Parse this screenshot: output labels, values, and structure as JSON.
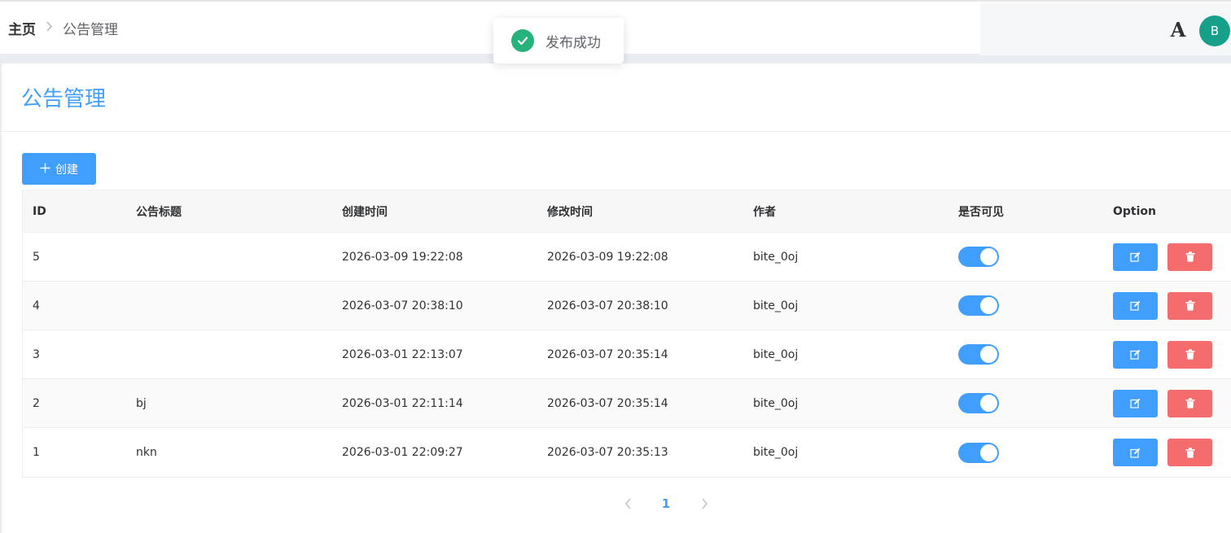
{
  "breadcrumb": {
    "home": "主页",
    "current": "公告管理"
  },
  "header": {
    "font_toggle": "A",
    "avatar_initial": "B"
  },
  "toast": {
    "message": "发布成功",
    "icon": "check-circle-icon",
    "color": "#26b27b"
  },
  "page": {
    "title": "公告管理",
    "create_label": "创建"
  },
  "table": {
    "columns": [
      "ID",
      "公告标题",
      "创建时间",
      "修改时间",
      "作者",
      "是否可见",
      "Option"
    ],
    "rows": [
      {
        "id": "5",
        "title": "",
        "created": "2026-03-09 19:22:08",
        "updated": "2026-03-09 19:22:08",
        "author": "bite_0oj",
        "visible": true
      },
      {
        "id": "4",
        "title": "",
        "created": "2026-03-07 20:38:10",
        "updated": "2026-03-07 20:38:10",
        "author": "bite_0oj",
        "visible": true
      },
      {
        "id": "3",
        "title": "",
        "created": "2026-03-01 22:13:07",
        "updated": "2026-03-07 20:35:14",
        "author": "bite_0oj",
        "visible": true
      },
      {
        "id": "2",
        "title": "bj",
        "created": "2026-03-01 22:11:14",
        "updated": "2026-03-07 20:35:14",
        "author": "bite_0oj",
        "visible": true
      },
      {
        "id": "1",
        "title": "nkn",
        "created": "2026-03-01 22:09:27",
        "updated": "2026-03-07 20:35:13",
        "author": "bite_0oj",
        "visible": true
      }
    ]
  },
  "pagination": {
    "current_page": "1"
  },
  "colors": {
    "primary": "#409eff",
    "danger": "#f56c6c",
    "success": "#26b27b",
    "avatar": "#16a08a"
  }
}
